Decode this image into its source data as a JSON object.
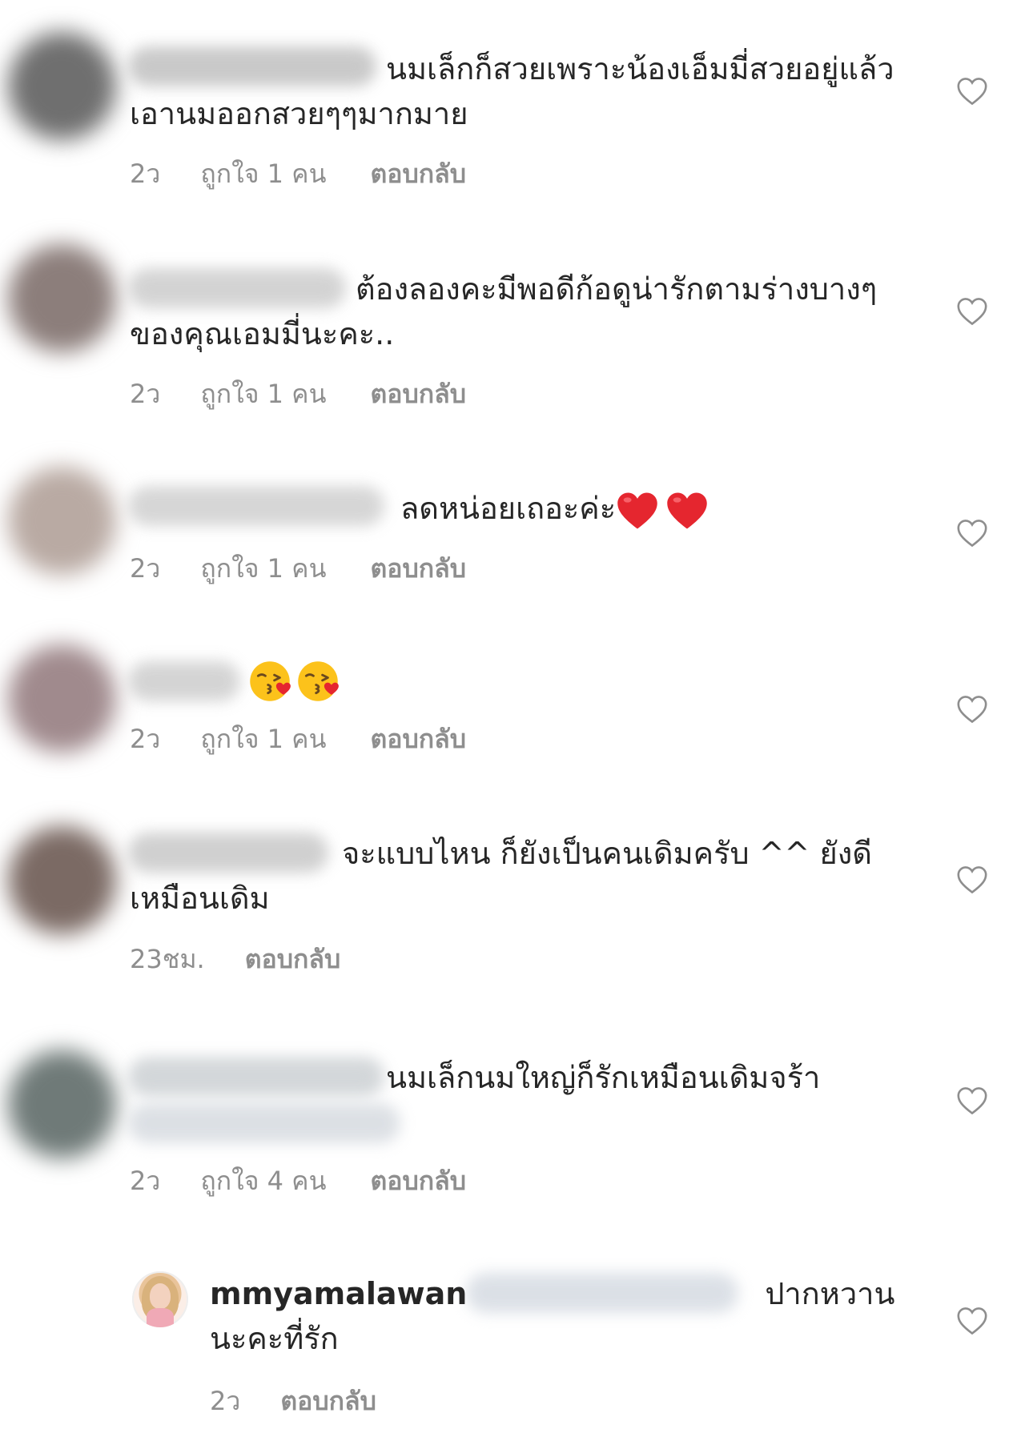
{
  "colors": {
    "text": "#262626",
    "secondary": "#8e8e8e",
    "heart_outline": "#8e8e8e",
    "emoji_heart": "#e5262f",
    "emoji_face": "#fcc21b"
  },
  "comments": [
    {
      "text": "นมเล็กก็สวยเพราะน้องเอ็มมี่สวยอยู่แล้วเอานมออกสวยๆๆมากมาย",
      "time": "2ว",
      "likes": "ถูกใจ 1 คน",
      "reply": "ตอบกลับ",
      "heart_icon": "heart-outline-icon"
    },
    {
      "text": "ต้องลองคะมีพอดีก้อดูน่ารักตามร่างบางๆของคุณเอมมี่นะคะ..",
      "time": "2ว",
      "likes": "ถูกใจ 1 คน",
      "reply": "ตอบกลับ",
      "heart_icon": "heart-outline-icon"
    },
    {
      "text": "ลดหน่อยเถอะค่ะ",
      "text_suffix_emojis": [
        "red-heart-emoji",
        "red-heart-emoji"
      ],
      "time": "2ว",
      "likes": "ถูกใจ 1 คน",
      "reply": "ตอบกลับ",
      "heart_icon": "heart-outline-icon"
    },
    {
      "text": "",
      "text_emojis": [
        "kissing-face-emoji",
        "kissing-face-emoji"
      ],
      "time": "2ว",
      "likes": "ถูกใจ 1 คน",
      "reply": "ตอบกลับ",
      "heart_icon": "heart-outline-icon"
    },
    {
      "text": "จะแบบไหน ก็ยังเป็นคนเดิมครับ ^^ ยังดีเหมือนเดิม",
      "time": "23ชม.",
      "reply": "ตอบกลับ",
      "heart_icon": "heart-outline-icon"
    },
    {
      "text": "นมเล็กนมใหญ่ก็รักเหมือนเดิมจร้า",
      "time": "2ว",
      "likes": "ถูกใจ 4 คน",
      "reply": "ตอบกลับ",
      "heart_icon": "heart-outline-icon"
    }
  ],
  "reply_comment": {
    "username": "mmyamalawan",
    "text": "ปากหวานนะคะที่รัก",
    "time": "2ว",
    "reply": "ตอบกลับ",
    "heart_icon": "heart-outline-icon"
  }
}
